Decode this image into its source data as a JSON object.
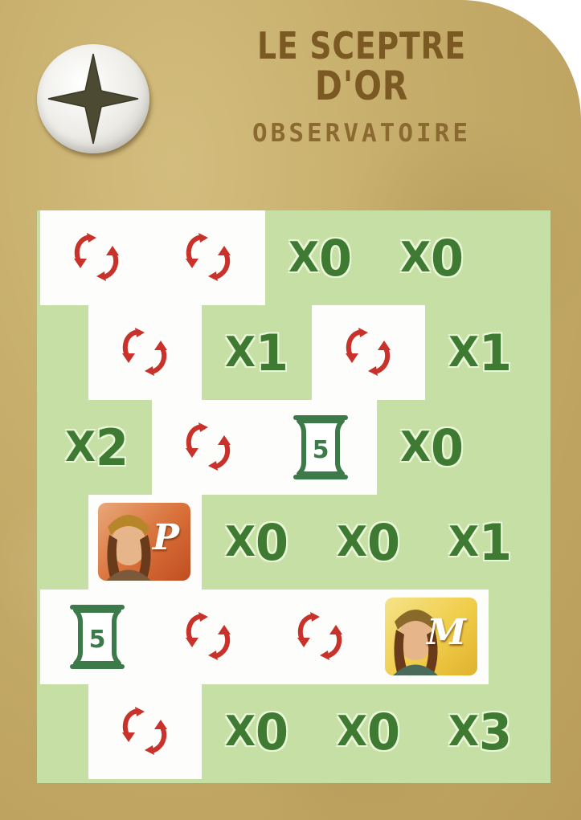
{
  "card": {
    "title_line1": "LE SCEPTRE",
    "title_line2": "D'OR",
    "subtitle": "OBSERVATOIRE",
    "badge_icon": "four-point-star-icon"
  },
  "colors": {
    "card_gold": "#c6ad6b",
    "title_brown": "#7a5a22",
    "grid_green": "#c6dfa4",
    "multiplier_green": "#3f7a32",
    "arrow_red": "#c8322a",
    "scroll_green": "#3d7a4a"
  },
  "grid": {
    "rows": [
      [
        {
          "type": "swap-arrows-icon",
          "bg": "white"
        },
        {
          "type": "swap-arrows-icon",
          "bg": "white"
        },
        {
          "type": "multiplier",
          "x": "X",
          "n": "0",
          "bg": "green"
        },
        {
          "type": "multiplier",
          "x": "X",
          "n": "0",
          "bg": "green"
        }
      ],
      [
        {
          "type": "swap-arrows-icon",
          "bg": "white"
        },
        {
          "type": "multiplier",
          "x": "X",
          "n": "1",
          "bg": "green"
        },
        {
          "type": "swap-arrows-icon",
          "bg": "white"
        },
        {
          "type": "multiplier",
          "x": "X",
          "n": "1",
          "bg": "green"
        }
      ],
      [
        {
          "type": "multiplier",
          "x": "X",
          "n": "2",
          "bg": "green"
        },
        {
          "type": "swap-arrows-icon",
          "bg": "white"
        },
        {
          "type": "scroll-icon",
          "value": "5",
          "bg": "white"
        },
        {
          "type": "multiplier",
          "x": "X",
          "n": "0",
          "bg": "green"
        }
      ],
      [
        {
          "type": "character",
          "letter": "P",
          "tile": "red",
          "bg": "white"
        },
        {
          "type": "multiplier",
          "x": "X",
          "n": "0",
          "bg": "green"
        },
        {
          "type": "multiplier",
          "x": "X",
          "n": "0",
          "bg": "green"
        },
        {
          "type": "multiplier",
          "x": "X",
          "n": "1",
          "bg": "green"
        }
      ],
      [
        {
          "type": "scroll-icon",
          "value": "5",
          "bg": "white"
        },
        {
          "type": "swap-arrows-icon",
          "bg": "white"
        },
        {
          "type": "swap-arrows-icon",
          "bg": "white"
        },
        {
          "type": "character",
          "letter": "M",
          "tile": "yellow",
          "bg": "white"
        }
      ],
      [
        {
          "type": "swap-arrows-icon",
          "bg": "white"
        },
        {
          "type": "multiplier",
          "x": "X",
          "n": "0",
          "bg": "green"
        },
        {
          "type": "multiplier",
          "x": "X",
          "n": "0",
          "bg": "green"
        },
        {
          "type": "multiplier",
          "x": "X",
          "n": "3",
          "bg": "green"
        }
      ]
    ]
  }
}
